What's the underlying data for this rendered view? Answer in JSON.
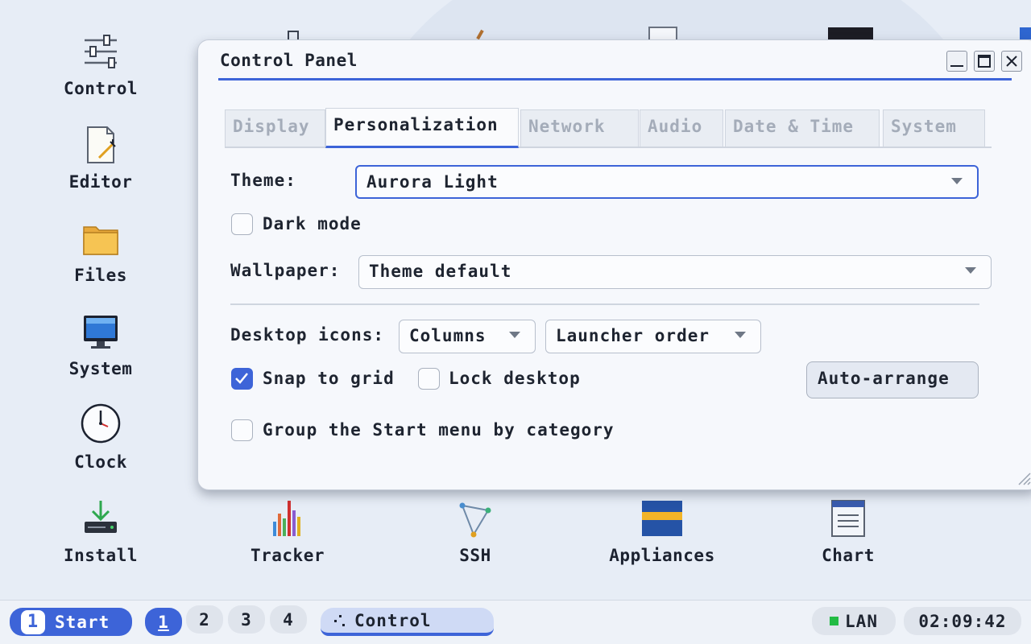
{
  "desktop": {
    "icons": [
      {
        "label": "Control",
        "icon": "sliders-icon"
      },
      {
        "label": "Editor",
        "icon": "editor-icon"
      },
      {
        "label": "Files",
        "icon": "folder-icon"
      },
      {
        "label": "System",
        "icon": "monitor-icon"
      },
      {
        "label": "Clock",
        "icon": "clock-icon"
      },
      {
        "label": "Install",
        "icon": "install-icon"
      },
      {
        "label": "Tracker",
        "icon": "bar-chart-icon"
      },
      {
        "label": "SSH",
        "icon": "network-icon"
      },
      {
        "label": "Appliances",
        "icon": "appliances-icon"
      },
      {
        "label": "Chart",
        "icon": "chart-document-icon"
      }
    ]
  },
  "window": {
    "title": "Control Panel",
    "controls": [
      "minimize-icon",
      "maximize-icon",
      "close-icon"
    ],
    "tabs": [
      {
        "label": "Display",
        "active": false
      },
      {
        "label": "Personalization",
        "active": true
      },
      {
        "label": "Network",
        "active": false
      },
      {
        "label": "Audio",
        "active": false
      },
      {
        "label": "Date & Time",
        "active": false
      },
      {
        "label": "System",
        "active": false
      }
    ],
    "theme": {
      "label": "Theme:",
      "value": "Aurora Light"
    },
    "dark_mode": {
      "label": "Dark mode",
      "checked": false
    },
    "wallpaper": {
      "label": "Wallpaper:",
      "value": "Theme default"
    },
    "desktop_icons": {
      "label": "Desktop icons:",
      "layout_value": "Columns",
      "order_value": "Launcher order"
    },
    "snap_to_grid": {
      "label": "Snap to grid",
      "checked": true
    },
    "lock_desktop": {
      "label": "Lock desktop",
      "checked": false
    },
    "auto_arrange_label": "Auto-arrange",
    "group_start": {
      "label": "Group the Start menu by category",
      "checked": false
    }
  },
  "taskbar": {
    "start": {
      "number": "1",
      "label": "Start"
    },
    "workspaces": [
      "1",
      "2",
      "3",
      "4"
    ],
    "active_workspace": "1",
    "task": {
      "label": "Control"
    },
    "network": {
      "label": "LAN",
      "status_color": "#22bb44"
    },
    "clock": "02:09:42"
  },
  "colors": {
    "accent": "#3d64d8",
    "checkbox_on": "#3d64d8"
  }
}
